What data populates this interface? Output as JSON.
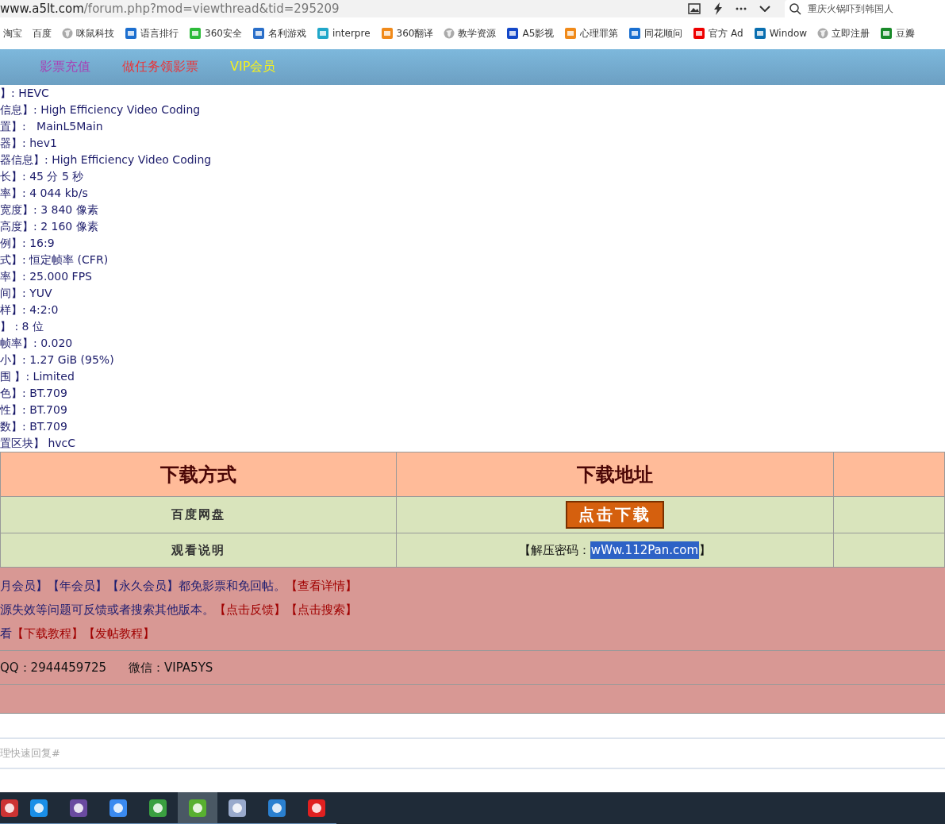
{
  "address_bar": {
    "domain": "www.a5lt.com",
    "path": "/forum.php?mod=viewthread&tid=295209",
    "search": {
      "placeholder": "重庆火锅吓到韩国人"
    }
  },
  "bookmarks": [
    {
      "label": "淘宝"
    },
    {
      "label": "百度"
    },
    {
      "label": "咪鼠科技"
    },
    {
      "label": "语言排行"
    },
    {
      "label": "360安全"
    },
    {
      "label": "名利游戏"
    },
    {
      "label": "interpre"
    },
    {
      "label": "360翻译"
    },
    {
      "label": "教学资源"
    },
    {
      "label": "A5影视"
    },
    {
      "label": "心理罪第"
    },
    {
      "label": "同花顺问"
    },
    {
      "label": "官方 Ad"
    },
    {
      "label": "Window"
    },
    {
      "label": "立即注册"
    },
    {
      "label": "豆瓣"
    }
  ],
  "nav": [
    {
      "label": "影票充值",
      "color": "#a743b5"
    },
    {
      "label": "做任务领影票",
      "color": "#e8363a"
    },
    {
      "label": "VIP会员",
      "color": "#f5f01e"
    }
  ],
  "info_lines": [
    "】: HEVC",
    "信息】: High Efficiency Video Coding",
    "置】:   MainL5Main",
    "器】: hev1",
    "器信息】: High Efficiency Video Coding",
    "长】: 45 分 5 秒",
    "率】: 4 044 kb/s",
    "宽度】: 3 840 像素",
    "高度】: 2 160 像素",
    "例】: 16:9",
    "式】: 恒定帧率 (CFR)",
    "率】: 25.000 FPS",
    "间】: YUV",
    "样】: 4:2:0",
    "】 : 8 位",
    "帧率】: 0.020",
    "小】: 1.27 GiB (95%)",
    "围 】: Limited",
    "色】: BT.709",
    "性】: BT.709",
    "数】: BT.709",
    "置区块】 hvcC"
  ],
  "download_table": {
    "columns": [
      "下载方式",
      "下载地址"
    ],
    "rows": [
      {
        "method": "百度网盘",
        "kind": "button",
        "button": "点击下载"
      },
      {
        "method": "观看说明",
        "kind": "password",
        "prefix": "【解压密码：",
        "value": "wWw.112Pan.com",
        "suffix": "】",
        "highlighted": true
      }
    ]
  },
  "notice": {
    "lines": [
      {
        "text": "月会员】【年会员】【永久会员】都免影票和免回帖。",
        "links": [
          "【查看详情】"
        ]
      },
      {
        "text": "源失效等问题可反馈或者搜索其他版本。",
        "links": [
          "【点击反馈】",
          "【点击搜索】"
        ]
      },
      {
        "text": "看",
        "links": [
          "【下载教程】",
          "【发帖教程】"
        ]
      }
    ],
    "qq": "QQ：2944459725",
    "wechat": "微信：VIPA5YS"
  },
  "reply": {
    "placeholder": "理快速回复#"
  },
  "taskbar": [
    {
      "selected": false
    },
    {
      "selected": false
    },
    {
      "selected": false
    },
    {
      "selected": false
    },
    {
      "selected": false
    },
    {
      "selected": true
    },
    {
      "selected": false
    },
    {
      "selected": false
    },
    {
      "selected": false
    }
  ]
}
